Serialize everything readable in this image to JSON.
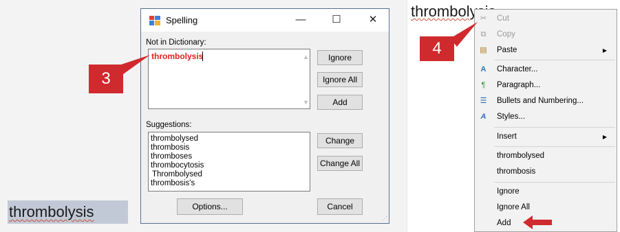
{
  "left_doc_word": "thrombolysis",
  "dialog": {
    "title": "Spelling",
    "controls": {
      "minimize": "—",
      "maximize": "☐",
      "close": "✕"
    },
    "not_in_dictionary_label": "Not in Dictionary:",
    "misspelled_word": "thrombolysis",
    "suggestions_label": "Suggestions:",
    "suggestions": [
      "thrombolysed",
      "thrombosis",
      "thromboses",
      "thrombocytosis",
      "Thrombolysed",
      "thrombosis's"
    ],
    "buttons": {
      "ignore": "Ignore",
      "ignore_all": "Ignore All",
      "add": "Add",
      "change": "Change",
      "change_all": "Change All",
      "options": "Options...",
      "cancel": "Cancel"
    }
  },
  "callouts": {
    "step3": "3",
    "step4": "4"
  },
  "right_doc_word": "thrombolysis",
  "context_menu": {
    "items": [
      {
        "label": "Cut",
        "icon": "scissors-icon",
        "disabled": true
      },
      {
        "label": "Copy",
        "icon": "copy-icon",
        "disabled": true
      },
      {
        "label": "Paste",
        "icon": "paste-icon",
        "submenu": true
      },
      {
        "label": "Character...",
        "icon": "font-icon"
      },
      {
        "label": "Paragraph...",
        "icon": "paragraph-icon"
      },
      {
        "label": "Bullets and Numbering...",
        "icon": "list-icon"
      },
      {
        "label": "Styles...",
        "icon": "styles-icon"
      },
      {
        "label": "Insert",
        "submenu": true
      },
      {
        "label": "thrombolysed"
      },
      {
        "label": "thrombosis"
      },
      {
        "label": "Ignore"
      },
      {
        "label": "Ignore All"
      },
      {
        "label": "Add"
      }
    ]
  },
  "colors": {
    "callout": "#cf2a2e",
    "misspelling": "#e02020",
    "selection": "#c2c9d6"
  }
}
